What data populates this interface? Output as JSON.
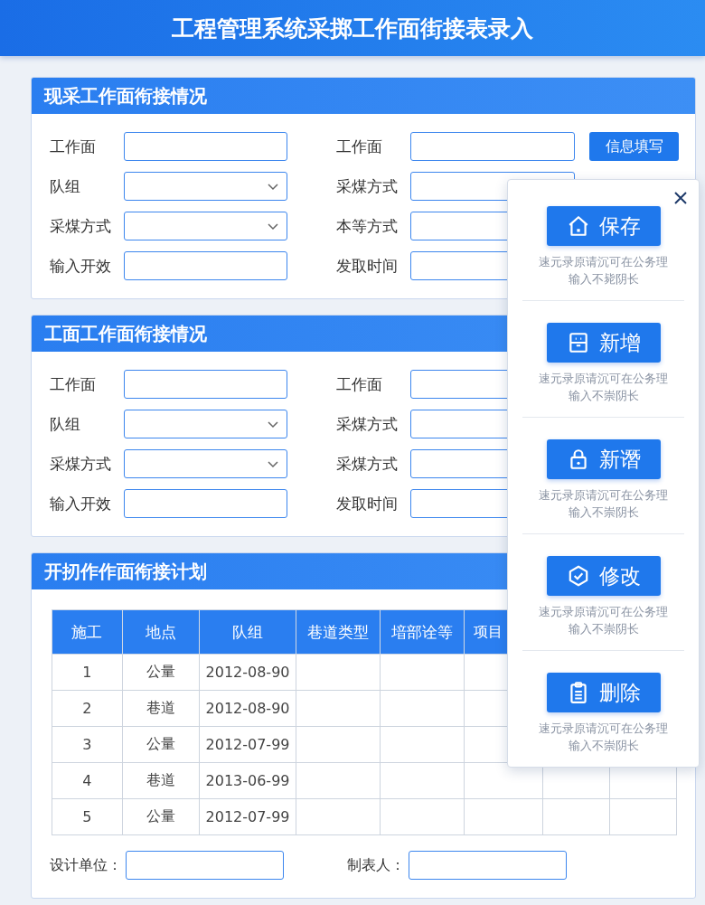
{
  "header": {
    "title": "工程管理系统采掷工作面街接表录入"
  },
  "sections": [
    {
      "title": "现采工作面衔接情况",
      "action": "信息填写",
      "rows": [
        {
          "left": {
            "label": "工作面",
            "kind": "text"
          },
          "right": {
            "label": "工作面"
          }
        },
        {
          "left": {
            "label": "队组",
            "kind": "select"
          },
          "right": {
            "label": "采煤方式"
          }
        },
        {
          "left": {
            "label": "采煤方式",
            "kind": "select"
          },
          "right": {
            "label": "本等方式"
          }
        },
        {
          "left": {
            "label": "输入开效",
            "kind": "text"
          },
          "right": {
            "label": "发取时间"
          }
        }
      ]
    },
    {
      "title": "工面工作面衔接情况",
      "rows": [
        {
          "left": {
            "label": "工作面",
            "kind": "text"
          },
          "right": {
            "label": "工作面"
          }
        },
        {
          "left": {
            "label": "队组",
            "kind": "select"
          },
          "right": {
            "label": "采煤方式"
          }
        },
        {
          "left": {
            "label": "采煤方式",
            "kind": "select"
          },
          "right": {
            "label": "采煤方式"
          }
        },
        {
          "left": {
            "label": "输入开效",
            "kind": "text"
          },
          "right": {
            "label": "发取时间"
          }
        }
      ]
    }
  ],
  "plan": {
    "title": "开扨作作面衔接计划",
    "table": {
      "columns": [
        "施工",
        "地点",
        "队组",
        "巷道类型",
        "堷部诠等",
        "项目"
      ],
      "rows": [
        [
          "1",
          "公量",
          "2012-08-90"
        ],
        [
          "2",
          "巷道",
          "2012-08-90"
        ],
        [
          "3",
          "公量",
          "2012-07-99"
        ],
        [
          "4",
          "巷道",
          "2013-06-99"
        ],
        [
          "5",
          "公量",
          "2012-07-99"
        ]
      ]
    },
    "footer": [
      {
        "label": "设计单位："
      },
      {
        "label": "制表人："
      }
    ]
  },
  "panel": {
    "actions": [
      {
        "label": "保存",
        "note": [
          "速元录原请沉可在公务理",
          "输入不毙阴长"
        ]
      },
      {
        "label": "新增",
        "note": [
          "速元录原请沉可在公务理",
          "输入不崇阴长"
        ]
      },
      {
        "label": "新谮",
        "note": [
          "速元录原请沉可在公务理",
          "输入不崇阴长"
        ]
      },
      {
        "label": "修改",
        "note": [
          "速元录原请沉可在公务理",
          "输入不崇阴长"
        ]
      },
      {
        "label": "删除",
        "note": [
          "速元录原请沉可在公务理",
          "输入不崇阴长"
        ]
      }
    ]
  }
}
